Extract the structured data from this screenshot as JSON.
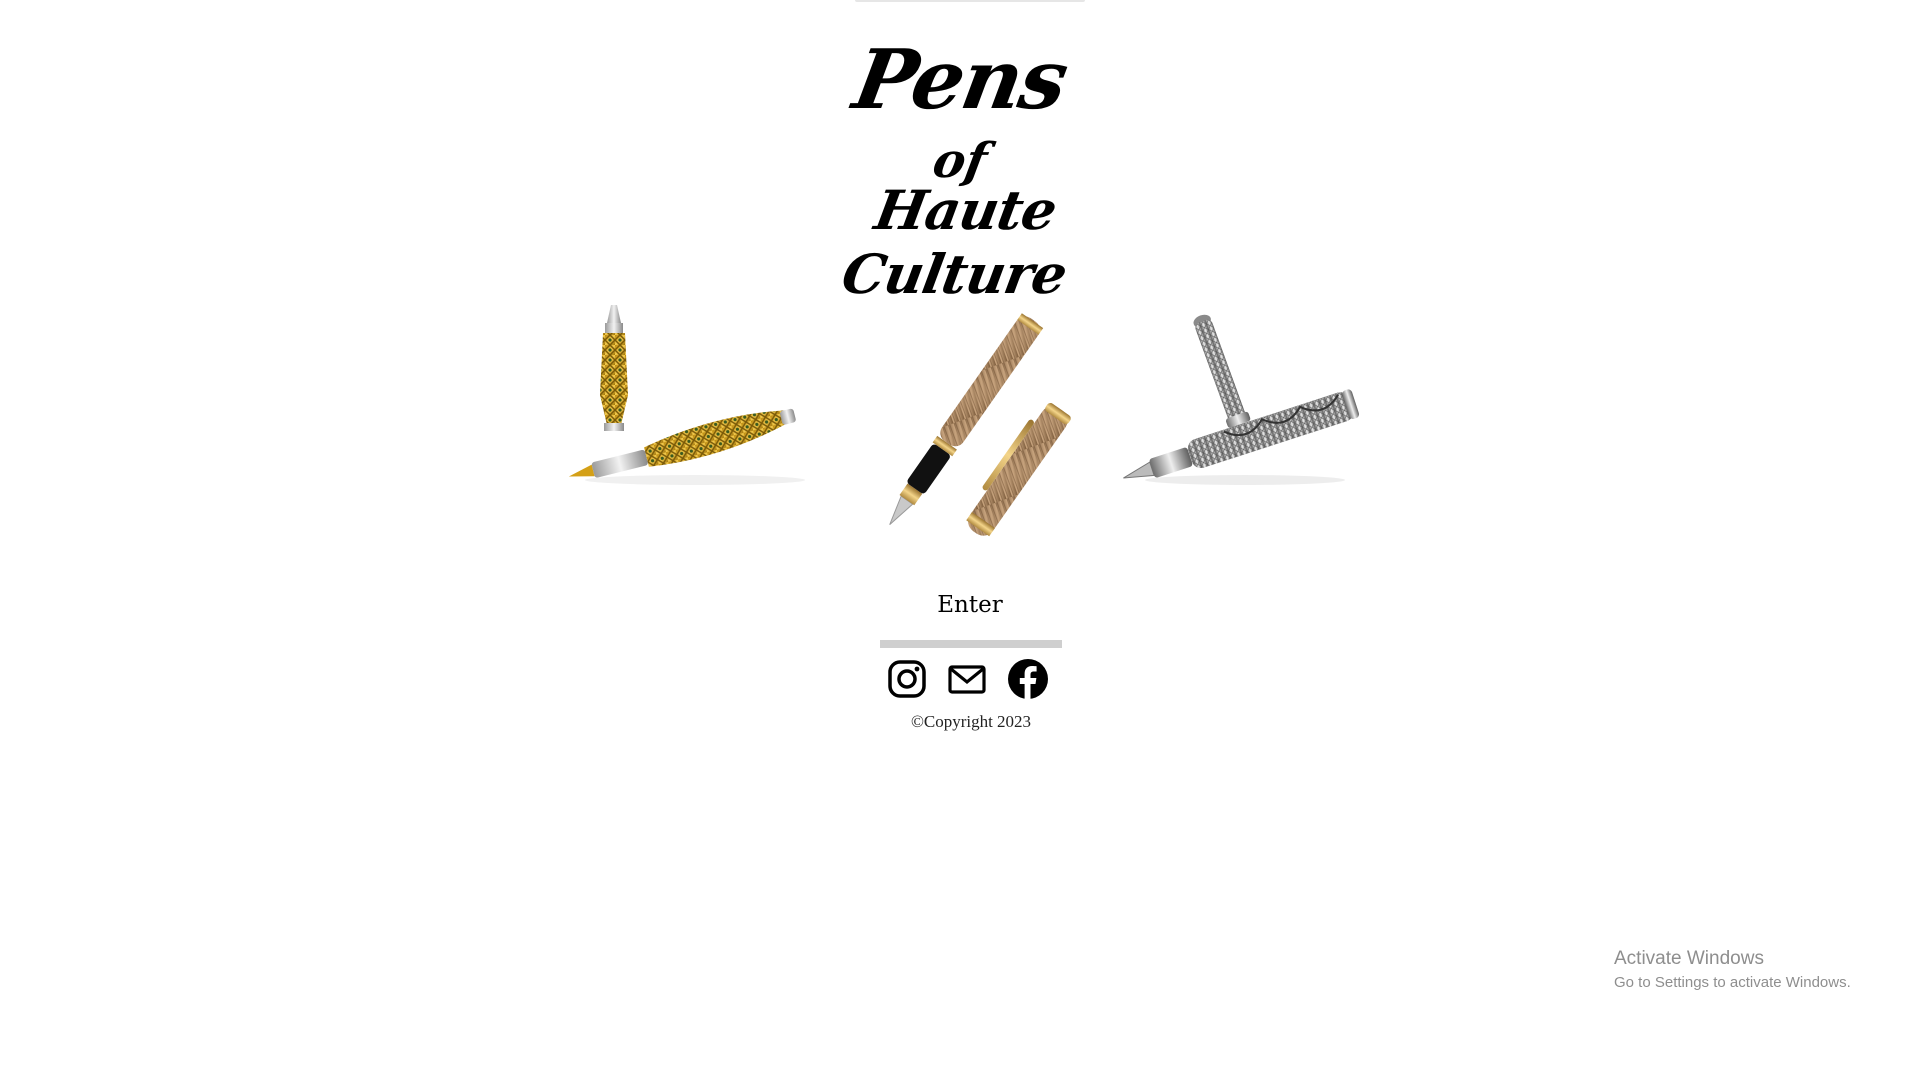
{
  "logo": {
    "line1": "Pens",
    "line2": "of",
    "line3": "Haute Culture"
  },
  "gallery": {
    "items": [
      {
        "name": "gold-lattice-fountain-pen"
      },
      {
        "name": "wooden-fountain-pen"
      },
      {
        "name": "silver-engraved-fountain-pen"
      }
    ]
  },
  "enter_label": "Enter",
  "social": {
    "icons": [
      "instagram-icon",
      "mail-icon",
      "facebook-icon"
    ]
  },
  "copyright": "©Copyright 2023",
  "watermark": {
    "title": "Activate Windows",
    "subtitle": "Go to Settings to activate Windows."
  },
  "colors": {
    "background": "#ffffff",
    "text": "#000000",
    "divider": "#cfcfcf",
    "watermark": "#8e8e8e"
  }
}
